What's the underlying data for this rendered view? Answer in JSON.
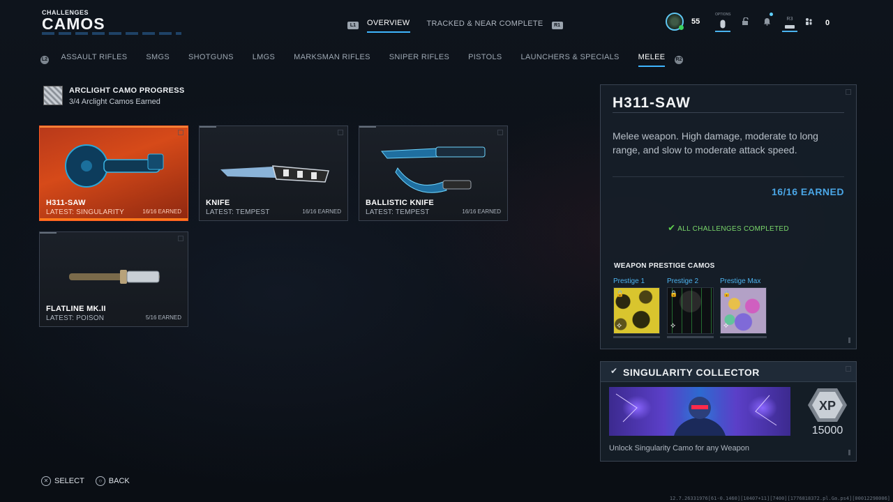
{
  "header": {
    "section": "CHALLENGES",
    "title": "CAMOS"
  },
  "top_tabs": {
    "left_button": "L1",
    "right_button": "R1",
    "items": [
      {
        "label": "OVERVIEW",
        "active": true
      },
      {
        "label": "TRACKED & NEAR COMPLETE",
        "active": false
      }
    ]
  },
  "hud": {
    "level": "55",
    "options_label": "OPTIONS",
    "r3_label": "R3",
    "friends_count": "0",
    "icons": [
      "player-avatar-icon",
      "options-controller-icon",
      "unlock-icon",
      "bell-icon",
      "r3-button-icon",
      "friends-icon"
    ]
  },
  "category_tabs": {
    "left_button": "L2",
    "right_button": "R2",
    "items": [
      {
        "label": "ASSAULT RIFLES",
        "active": false
      },
      {
        "label": "SMGS",
        "active": false
      },
      {
        "label": "SHOTGUNS",
        "active": false
      },
      {
        "label": "LMGS",
        "active": false
      },
      {
        "label": "MARKSMAN RIFLES",
        "active": false
      },
      {
        "label": "SNIPER RIFLES",
        "active": false
      },
      {
        "label": "PISTOLS",
        "active": false
      },
      {
        "label": "LAUNCHERS & SPECIALS",
        "active": false
      },
      {
        "label": "MELEE",
        "active": true
      }
    ]
  },
  "arclight": {
    "title": "ARCLIGHT CAMO PROGRESS",
    "subtitle": "3/4 Arclight Camos Earned"
  },
  "weapons": [
    {
      "name": "H311-SAW",
      "latest": "LATEST: SINGULARITY",
      "earned": "16/16 EARNED",
      "selected": true
    },
    {
      "name": "KNIFE",
      "latest": "LATEST: TEMPEST",
      "earned": "16/16 EARNED",
      "selected": false
    },
    {
      "name": "BALLISTIC KNIFE",
      "latest": "LATEST: TEMPEST",
      "earned": "16/16 EARNED",
      "selected": false
    },
    {
      "name": "FLATLINE MK.II",
      "latest": "LATEST: POISON",
      "earned": "5/16 EARNED",
      "selected": false
    }
  ],
  "detail": {
    "title": "H311-SAW",
    "description": "Melee weapon. High damage, moderate to long range, and slow to moderate attack speed.",
    "earned": "16/16 EARNED",
    "complete": "ALL CHALLENGES COMPLETED",
    "prestige_heading": "WEAPON PRESTIGE CAMOS",
    "prestige": [
      {
        "label": "Prestige 1"
      },
      {
        "label": "Prestige 2"
      },
      {
        "label": "Prestige Max"
      }
    ]
  },
  "challenge": {
    "title": "SINGULARITY COLLECTOR",
    "xp_label": "XP",
    "xp_value": "15000",
    "description": "Unlock Singularity Camo for any Weapon"
  },
  "footer": {
    "select": "SELECT",
    "back": "BACK"
  },
  "build_string": "12.7.26331976[61-0.1460][10407+11][7400][1776818372.pl.Ga.ps4][00012298006]",
  "colors": {
    "accent": "#3fb6ff",
    "selected_card": "#d64a19",
    "complete_green": "#5fd04e",
    "earned_blue": "#4aa6e6"
  }
}
